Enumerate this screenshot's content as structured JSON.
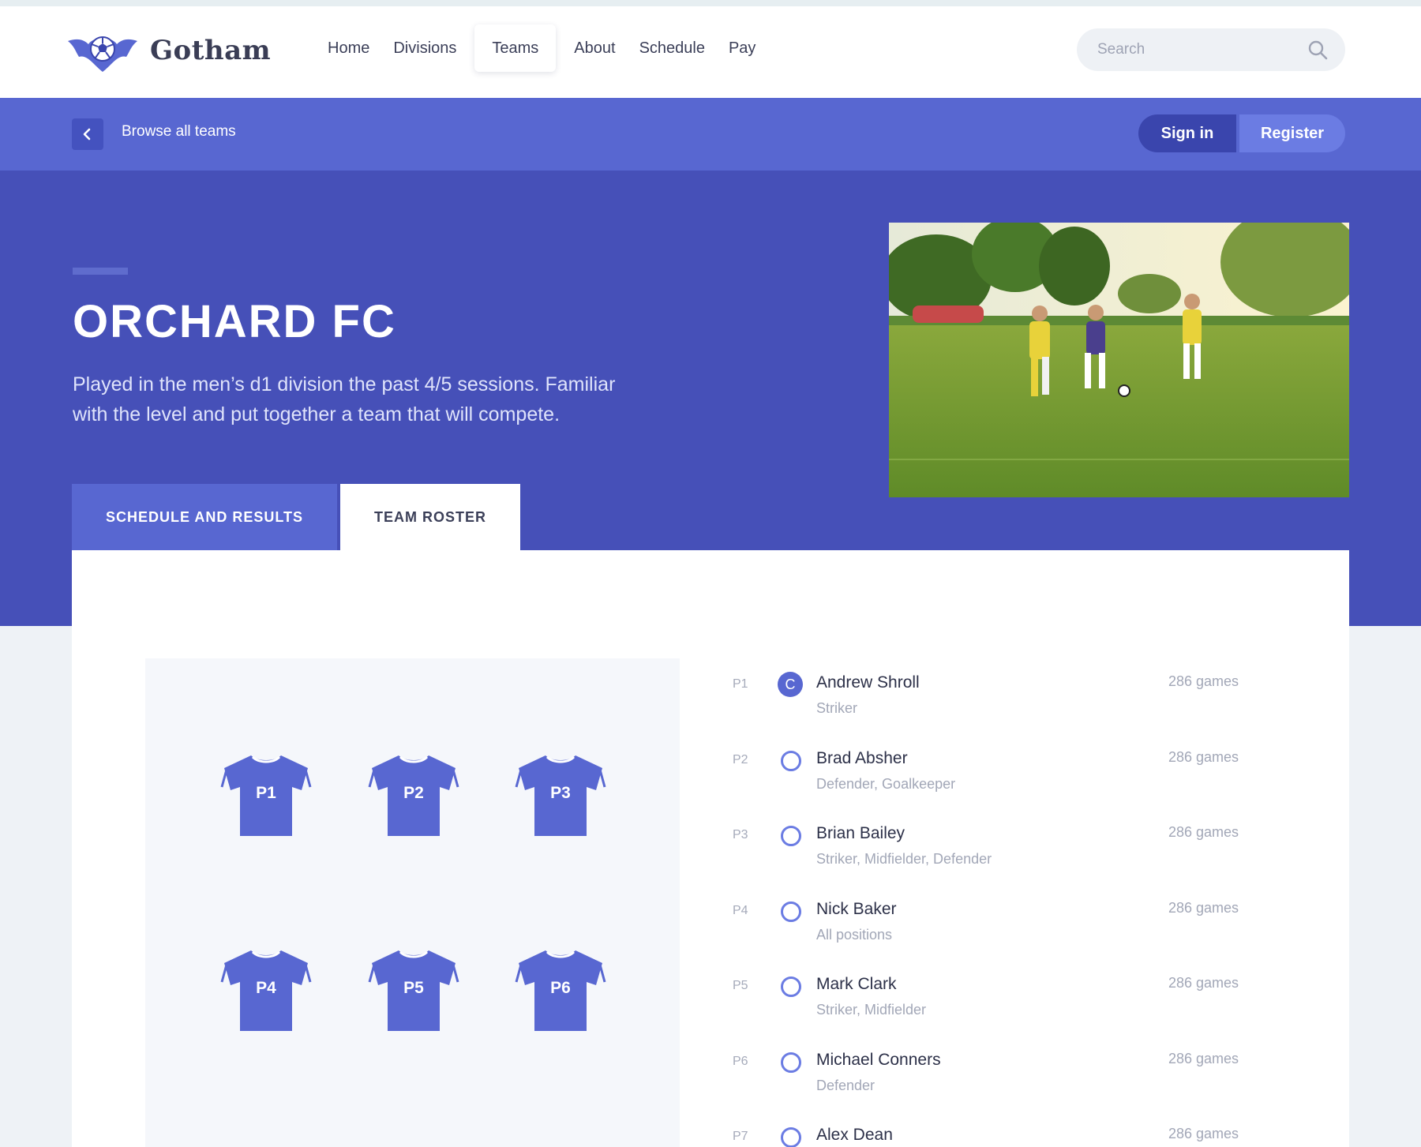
{
  "brand": {
    "name": "Gotham",
    "logo_icon": "bat-soccer-ball-icon",
    "accent": "#5867d1"
  },
  "nav": {
    "items": [
      {
        "label": "Home",
        "active": false
      },
      {
        "label": "Divisions",
        "active": false
      },
      {
        "label": "Teams",
        "active": true
      },
      {
        "label": "About",
        "active": false
      },
      {
        "label": "Schedule",
        "active": false
      },
      {
        "label": "Pay",
        "active": false
      }
    ]
  },
  "search": {
    "placeholder": "Search",
    "value": "",
    "icon": "search-icon"
  },
  "subbar": {
    "back_icon": "chevron-left-icon",
    "browse_label": "Browse all teams",
    "sign_in_label": "Sign in",
    "register_label": "Register"
  },
  "team": {
    "name": "ORCHARD FC",
    "description": "Played in the men’s d1 division the past 4/5 sessions. Familiar with the level and put together a team that will compete."
  },
  "tabs": [
    {
      "label": "SCHEDULE AND RESULTS",
      "active": false
    },
    {
      "label": "TEAM ROSTER",
      "active": true
    }
  ],
  "field": {
    "jerseys": [
      "P1",
      "P2",
      "P3",
      "P4",
      "P5",
      "P6"
    ]
  },
  "roster": [
    {
      "slot": "P1",
      "name": "Andrew Shroll",
      "positions": "Striker",
      "games": "286 games",
      "captain": true,
      "captain_label": "C"
    },
    {
      "slot": "P2",
      "name": "Brad Absher",
      "positions": "Defender, Goalkeeper",
      "games": "286 games",
      "captain": false
    },
    {
      "slot": "P3",
      "name": "Brian Bailey",
      "positions": "Striker, Midfielder, Defender",
      "games": "286 games",
      "captain": false
    },
    {
      "slot": "P4",
      "name": "Nick Baker",
      "positions": "All positions",
      "games": "286 games",
      "captain": false
    },
    {
      "slot": "P5",
      "name": "Mark Clark",
      "positions": "Striker, Midfielder",
      "games": "286 games",
      "captain": false
    },
    {
      "slot": "P6",
      "name": "Michael Conners",
      "positions": "Defender",
      "games": "286 games",
      "captain": false
    },
    {
      "slot": "P7",
      "name": "Alex Dean",
      "positions": "",
      "games": "286 games",
      "captain": false
    }
  ]
}
